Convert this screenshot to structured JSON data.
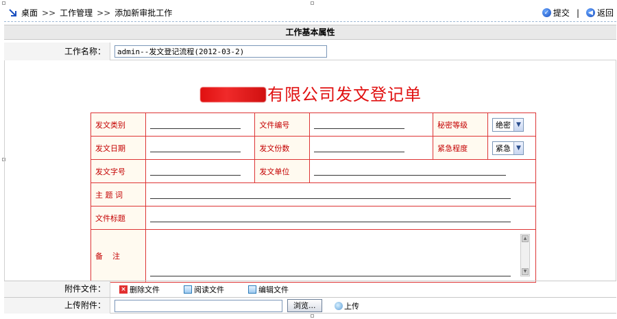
{
  "breadcrumb": {
    "items": [
      "桌面",
      "工作管理",
      "添加新审批工作"
    ],
    "separator": ">>"
  },
  "actions": {
    "submit": "提交",
    "divider": "|",
    "back": "返回"
  },
  "section": {
    "title": "工作基本属性"
  },
  "work_name": {
    "label": "工作名称：",
    "value": "admin--发文登记流程(2012-03-2)"
  },
  "form": {
    "title_suffix": "有限公司发文登记单",
    "fields": {
      "doc_category": "发文类别",
      "doc_number": "文件编号",
      "secret_level": "秘密等级",
      "secret_value": "绝密",
      "doc_date": "发文日期",
      "doc_copies": "发文份数",
      "urgency": "紧急程度",
      "urgency_value": "紧急",
      "doc_code": "发文字号",
      "doc_unit": "发文单位",
      "keywords": "主 题 词",
      "doc_title": "文件标题",
      "remarks": "备    注"
    }
  },
  "attachments": {
    "label": "附件文件：",
    "delete": "删除文件",
    "read": "阅读文件",
    "edit": "编辑文件"
  },
  "upload": {
    "label": "上传附件：",
    "browse": "浏览...",
    "upload": "上传"
  },
  "colors": {
    "form_red": "#c40000",
    "title_red": "#e01010",
    "header_gray": "#e9e9e9"
  }
}
